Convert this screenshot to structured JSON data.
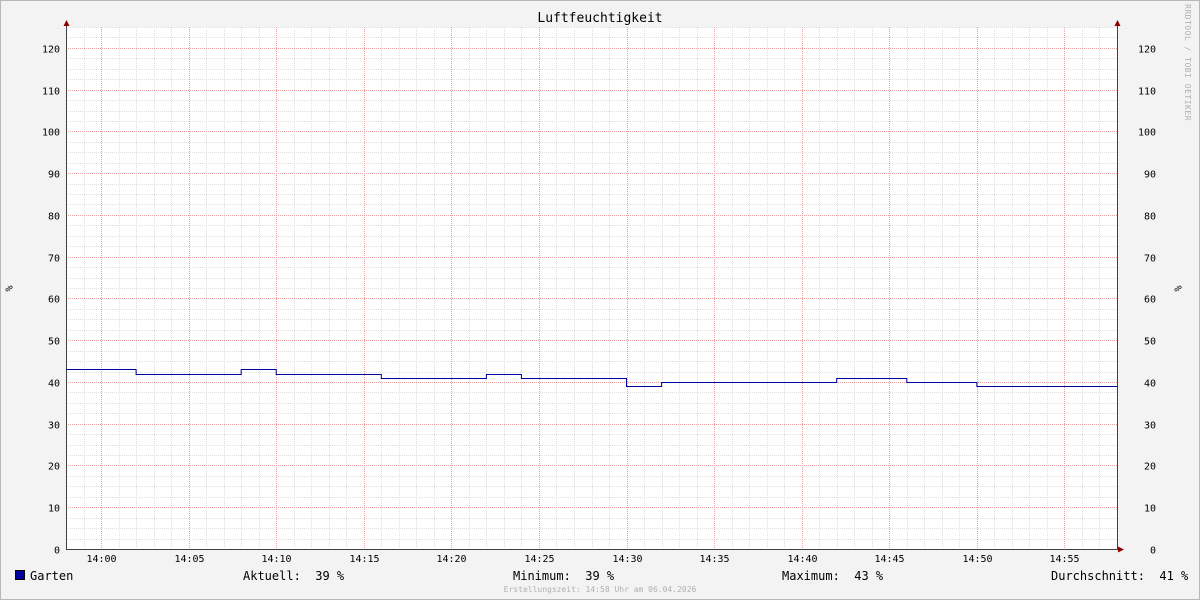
{
  "chart_data": {
    "type": "line",
    "title": "Luftfeuchtigkeit",
    "ylabel": "%",
    "ylim": [
      0,
      125
    ],
    "y_ticks": [
      0,
      10,
      20,
      30,
      40,
      50,
      60,
      70,
      80,
      90,
      100,
      110,
      120
    ],
    "x_tick_labels": [
      "14:00",
      "14:05",
      "14:10",
      "14:15",
      "14:20",
      "14:25",
      "14:30",
      "14:35",
      "14:40",
      "14:45",
      "14:50",
      "14:55"
    ],
    "x_tick_minutes": [
      0,
      5,
      10,
      15,
      20,
      25,
      30,
      35,
      40,
      45,
      50,
      55
    ],
    "xlim_minutes": [
      -2,
      58
    ],
    "grid": true,
    "series": [
      {
        "name": "Garten",
        "color": "#0000a0",
        "step_minutes": [
          -2,
          2,
          8,
          10,
          16,
          22,
          24,
          30,
          32,
          42,
          46,
          50
        ],
        "step_values": [
          43,
          42,
          43,
          42,
          41,
          42,
          41,
          39,
          40,
          41,
          40,
          39
        ],
        "end_minute": 58
      }
    ]
  },
  "legend": {
    "series_name": "Garten",
    "current": "Aktuell:  39 %",
    "minimum": "Minimum:  39 %",
    "maximum": "Maximum:  43 %",
    "average": "Durchschnitt:  41 %"
  },
  "watermark": "RRDTOOL / TOBI OETIKER",
  "footer": "Erstellungszeit: 14:58 Uhr am 06.04.2026"
}
